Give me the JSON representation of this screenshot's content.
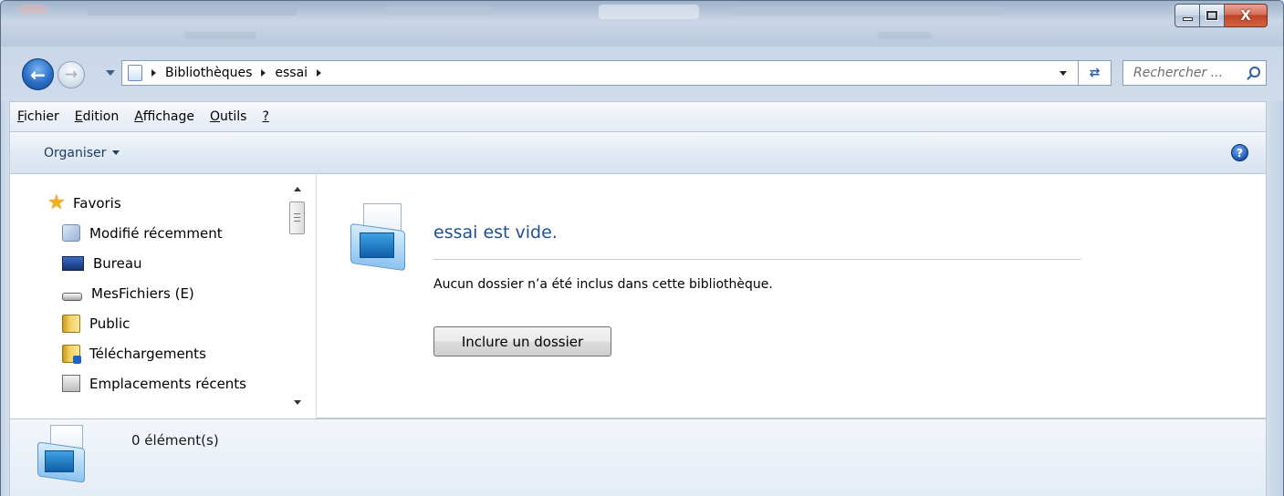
{
  "window": {
    "buttons": {
      "minimize": "–",
      "maximize": "□",
      "close": "X"
    }
  },
  "nav": {
    "back_icon": "back-arrow-icon",
    "forward_icon": "forward-arrow-icon",
    "breadcrumb": [
      "Bibliothèques",
      "essai"
    ],
    "search_placeholder": "Rechercher ..."
  },
  "menu": {
    "items": [
      {
        "accel": "F",
        "rest": "ichier"
      },
      {
        "accel": "E",
        "rest": "dition"
      },
      {
        "accel": "A",
        "rest": "ffichage"
      },
      {
        "accel": "O",
        "rest": "utils"
      },
      {
        "accel": "?",
        "rest": ""
      }
    ]
  },
  "toolbar": {
    "organiser_label": "Organiser",
    "help_label": "?"
  },
  "sidebar": {
    "favorites_label": "Favoris",
    "items": [
      {
        "label": "Modifié récemment",
        "icon": "recent-icon"
      },
      {
        "label": "Bureau",
        "icon": "desktop-icon"
      },
      {
        "label": "MesFichiers (E)",
        "icon": "drive-icon"
      },
      {
        "label": "Public",
        "icon": "folder-icon"
      },
      {
        "label": "Téléchargements",
        "icon": "downloads-folder-icon"
      },
      {
        "label": "Emplacements récents",
        "icon": "recent-places-icon"
      }
    ]
  },
  "main": {
    "empty_title": "essai est vide.",
    "empty_description": "Aucun dossier n’a été inclus dans cette bibliothèque.",
    "include_button": "Inclure un dossier"
  },
  "details": {
    "count": "0 élément(s)"
  }
}
